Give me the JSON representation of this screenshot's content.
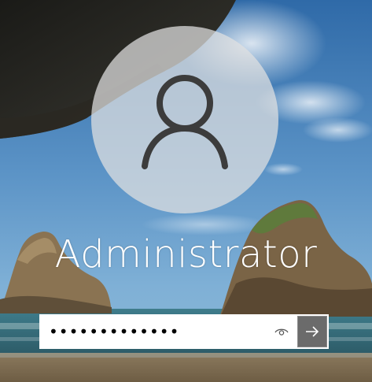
{
  "lock_screen": {
    "user": {
      "name": "Administrator",
      "avatar_icon": "user-silhouette-icon"
    },
    "password": {
      "value": "•••••••••••••",
      "reveal_icon": "eye-icon",
      "submit_icon": "arrow-right-icon"
    },
    "colors": {
      "sky": "#4f86b9",
      "avatar_circle": "#e1e1e1",
      "submit_button": "#6b6b6b",
      "text": "#ffffff"
    }
  }
}
